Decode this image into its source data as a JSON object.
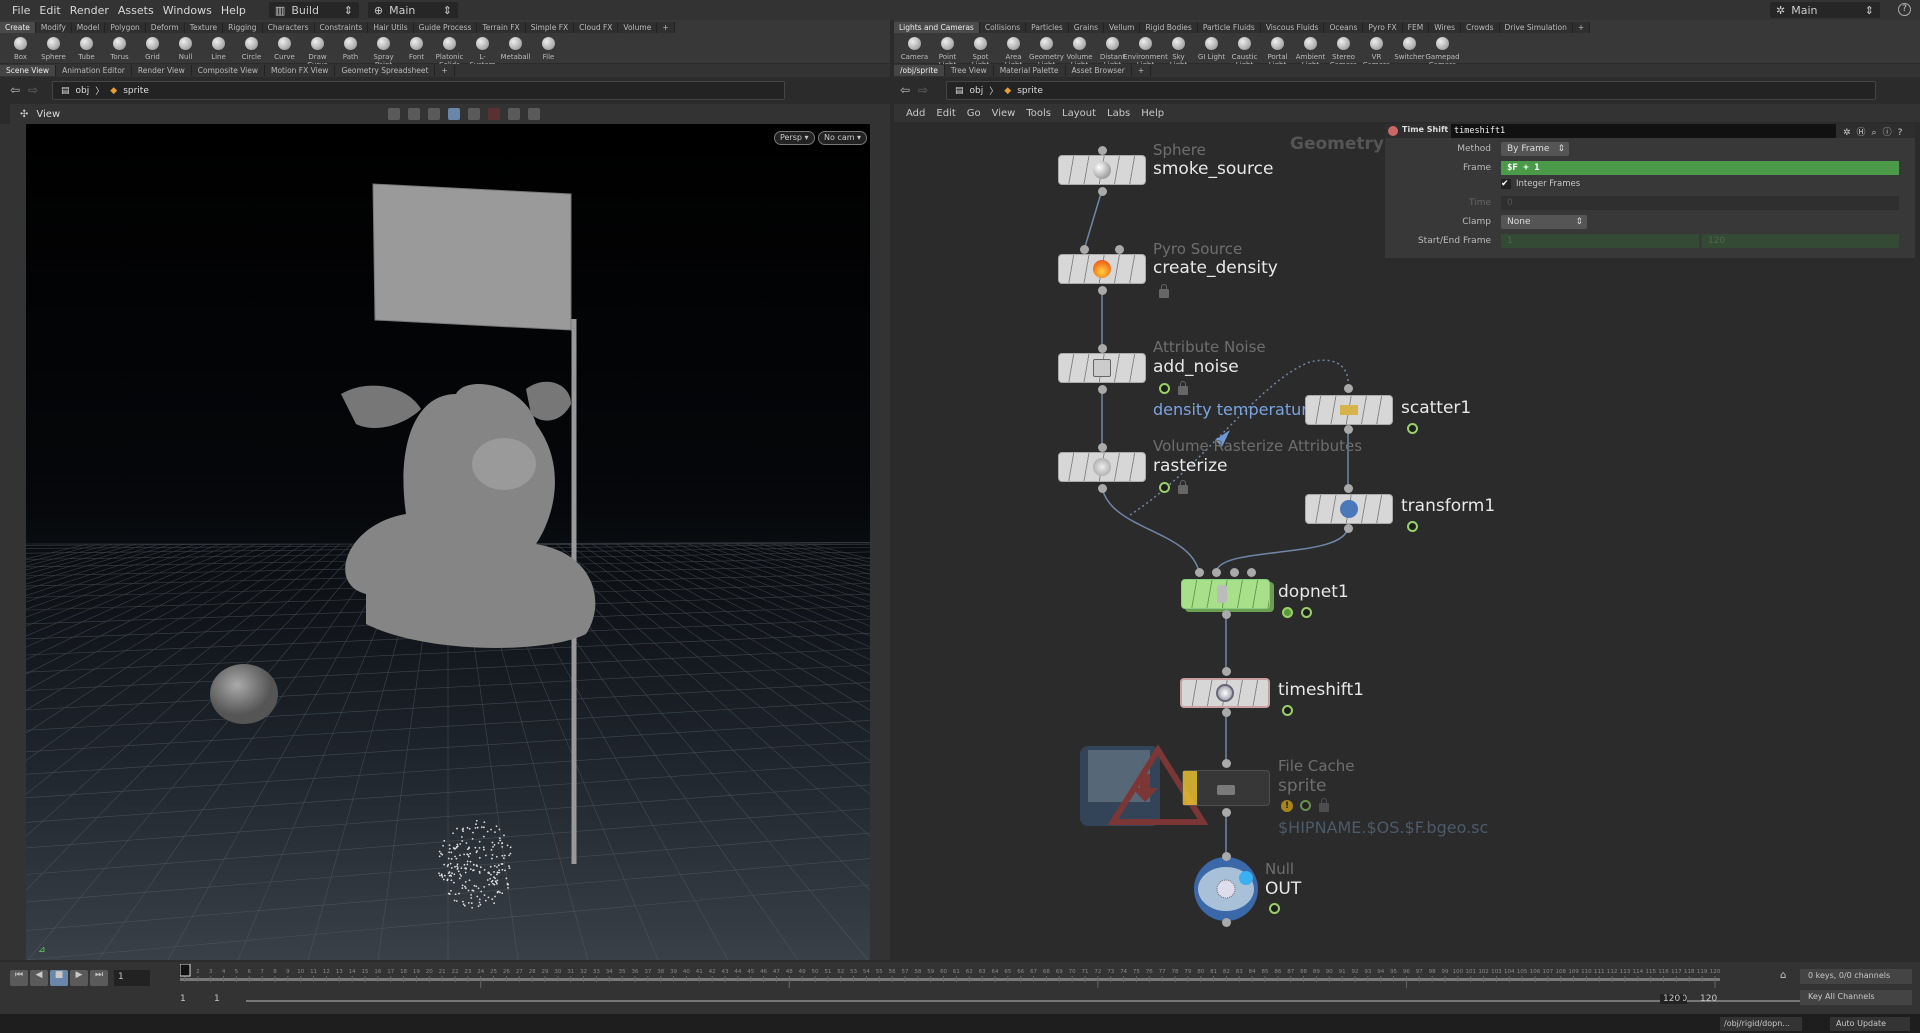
{
  "menu": [
    "File",
    "Edit",
    "Render",
    "Assets",
    "Windows",
    "Help"
  ],
  "desktop": "Build",
  "context_left": "Main",
  "context_right": "Main",
  "shelf_left": {
    "tabs": [
      "Create",
      "Modify",
      "Model",
      "Polygon",
      "Deform",
      "Texture",
      "Rigging",
      "Characters",
      "Constraints",
      "Hair Utils",
      "Guide Process",
      "Terrain FX",
      "Simple FX",
      "Cloud FX",
      "Volume"
    ],
    "tools": [
      "Box",
      "Sphere",
      "Tube",
      "Torus",
      "Grid",
      "Null",
      "Line",
      "Circle",
      "Curve",
      "Draw Curve",
      "Path",
      "Spray Paint",
      "Font",
      "Platonic Solids",
      "L-System",
      "Metaball",
      "File"
    ]
  },
  "shelf_right": {
    "tabs": [
      "Lights and Cameras",
      "Collisions",
      "Particles",
      "Grains",
      "Vellum",
      "Rigid Bodies",
      "Particle Fluids",
      "Viscous Fluids",
      "Oceans",
      "Pyro FX",
      "FEM",
      "Wires",
      "Crowds",
      "Drive Simulation"
    ],
    "tools": [
      "Camera",
      "Point Light",
      "Spot Light",
      "Area Light",
      "Geometry Light",
      "Volume Light",
      "Distant Light",
      "Environment Light",
      "Sky Light",
      "GI Light",
      "Caustic Light",
      "Portal Light",
      "Ambient Light",
      "Stereo Camera",
      "VR Camera",
      "Switcher",
      "Gamepad Camera"
    ]
  },
  "left_pane": {
    "tabs": [
      "Scene View",
      "Animation Editor",
      "Render View",
      "Composite View",
      "Motion FX View",
      "Geometry Spreadsheet"
    ],
    "path": [
      "obj",
      "sprite"
    ],
    "view_label": "View",
    "persp": "Persp ▾",
    "cam": "No cam ▾"
  },
  "right_pane": {
    "tabs": [
      "/obj/sprite",
      "Tree View",
      "Material Palette",
      "Asset Browser"
    ],
    "path": [
      "obj",
      "sprite"
    ],
    "menu": [
      "Add",
      "Edit",
      "Go",
      "View",
      "Tools",
      "Layout",
      "Labs",
      "Help"
    ],
    "context_label": "Geometry"
  },
  "params": {
    "type": "Time Shift",
    "name": "timeshift1",
    "method_label": "Method",
    "method": "By Frame",
    "frame_label": "Frame",
    "frame": "$F + 1",
    "integer_frames": "Integer Frames",
    "integer_frames_checked": true,
    "time_label": "Time",
    "time": "0",
    "clamp_label": "Clamp",
    "clamp": "None",
    "startend_label": "Start/End Frame",
    "start": "1",
    "end": "120"
  },
  "nodes": {
    "smoke_source": {
      "type": "Sphere",
      "name": "smoke_source"
    },
    "create_density": {
      "type": "Pyro Source",
      "name": "create_density"
    },
    "add_noise": {
      "type": "Attribute Noise",
      "name": "add_noise",
      "note": "density temperature"
    },
    "rasterize": {
      "type": "Volume Rasterize Attributes",
      "name": "rasterize"
    },
    "scatter1": {
      "name": "scatter1"
    },
    "transform1": {
      "name": "transform1"
    },
    "dopnet1": {
      "name": "dopnet1"
    },
    "timeshift1": {
      "name": "timeshift1"
    },
    "filecache": {
      "type": "File Cache",
      "name": "sprite",
      "path": "$HIPNAME.$OS.$F.bgeo.sc"
    },
    "out": {
      "type": "Null",
      "name": "OUT"
    }
  },
  "timeline": {
    "current_frame": "1",
    "start": 1,
    "end": 120,
    "range_start": "1",
    "range_start2": "1",
    "range_end": "120",
    "range_end2": "120",
    "keys": "0 keys, 0/0 channels",
    "key_all": "Key All Channels"
  },
  "status": {
    "path": "/obj/rigid/dopn...",
    "update": "Auto Update"
  },
  "colors": {
    "accent_green": "#4a9a4a",
    "dopnet": "#a8e08a",
    "wire": "#6f86a8"
  }
}
